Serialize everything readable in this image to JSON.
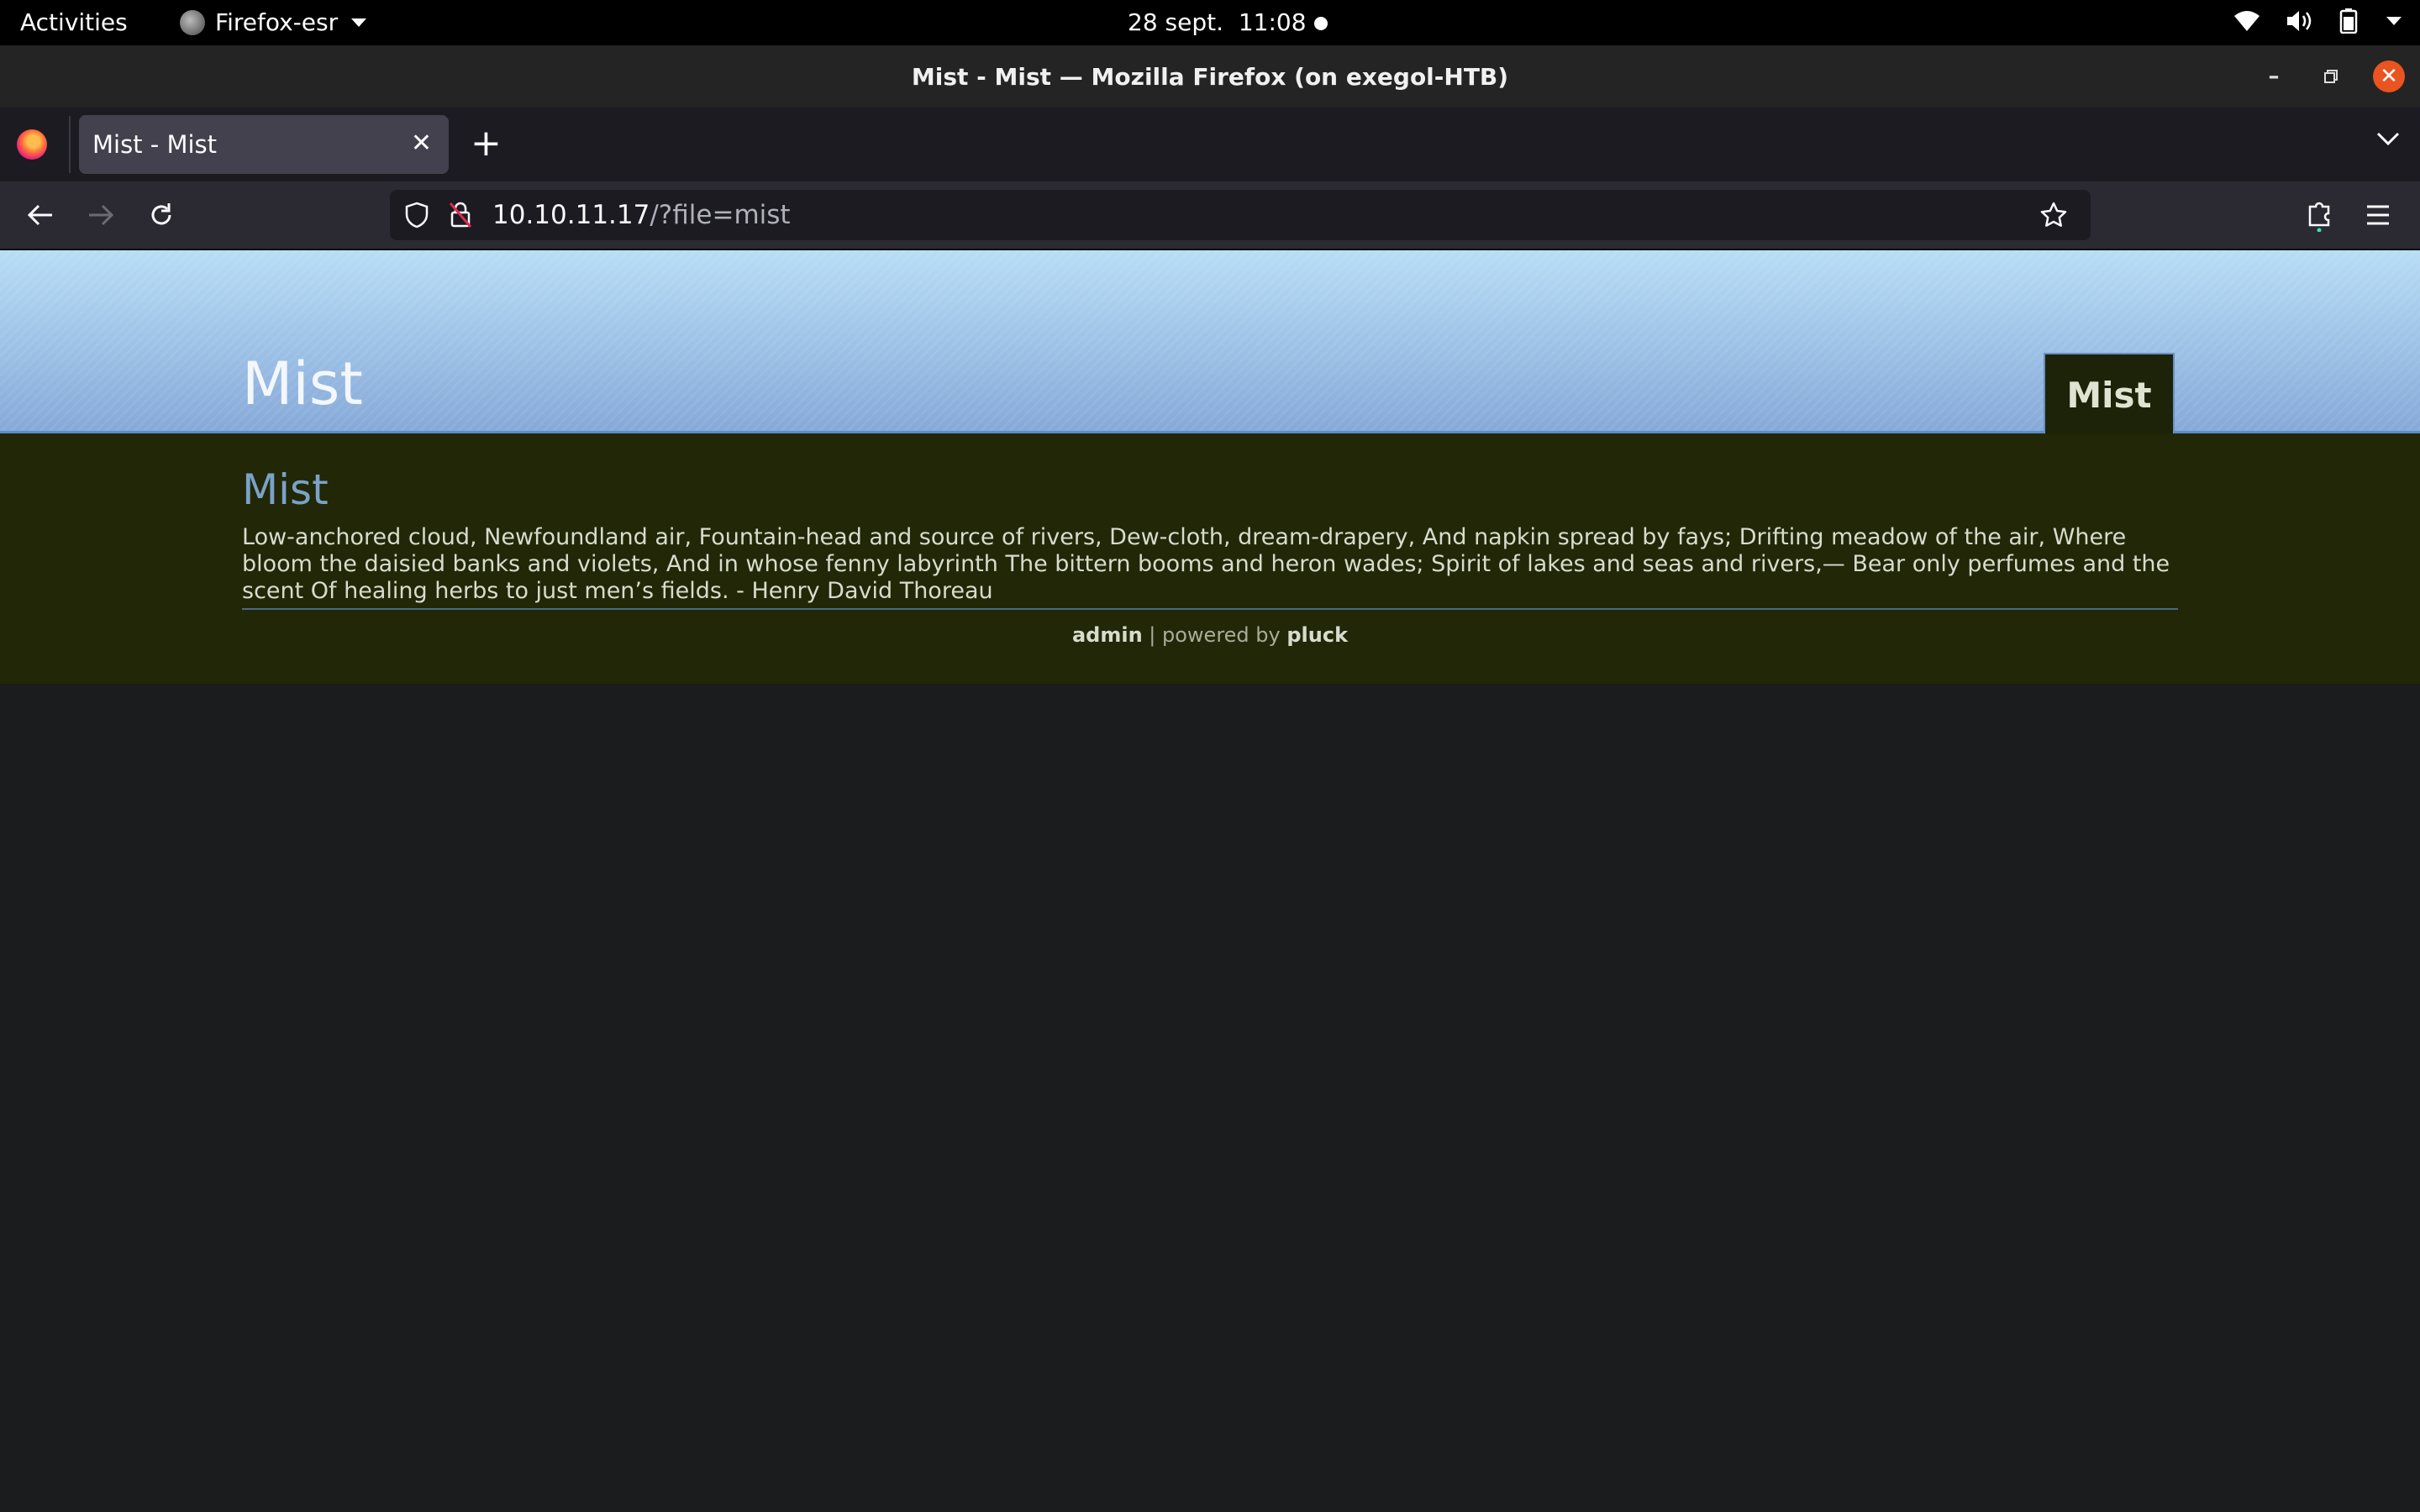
{
  "system": {
    "activities": "Activities",
    "app_name": "Firefox-esr",
    "clock_date": "28 sept.",
    "clock_time": "11:08",
    "tray_icons": [
      "wifi-icon",
      "volume-icon",
      "battery-icon",
      "system-menu-caret"
    ]
  },
  "window": {
    "title": "Mist - Mist — Mozilla Firefox (on exegol-HTB)"
  },
  "browser": {
    "tab_title": "Mist - Mist",
    "url_host": "10.10.11.17",
    "url_path": "/?file=mist"
  },
  "site": {
    "title": "Mist",
    "menu_item": "Mist",
    "page_title": "Mist",
    "body": "Low-anchored cloud, Newfoundland air, Fountain-head and source of rivers, Dew-cloth, dream-drapery, And napkin spread by fays; Drifting meadow of the air, Where bloom the daisied banks and violets, And in whose fenny labyrinth The bittern booms and heron wades; Spirit of lakes and seas and rivers,— Bear only perfumes and the scent Of healing herbs to just men’s fields. - Henry David Thoreau",
    "footer_admin": "admin",
    "footer_sep": " | powered by ",
    "footer_pluck": "pluck"
  },
  "colors": {
    "accent_close": "#e95420",
    "header_top": "#b8ddf6",
    "header_bottom": "#86a9d8",
    "content_bg": "#212707",
    "link_title": "#7ba2c7"
  }
}
